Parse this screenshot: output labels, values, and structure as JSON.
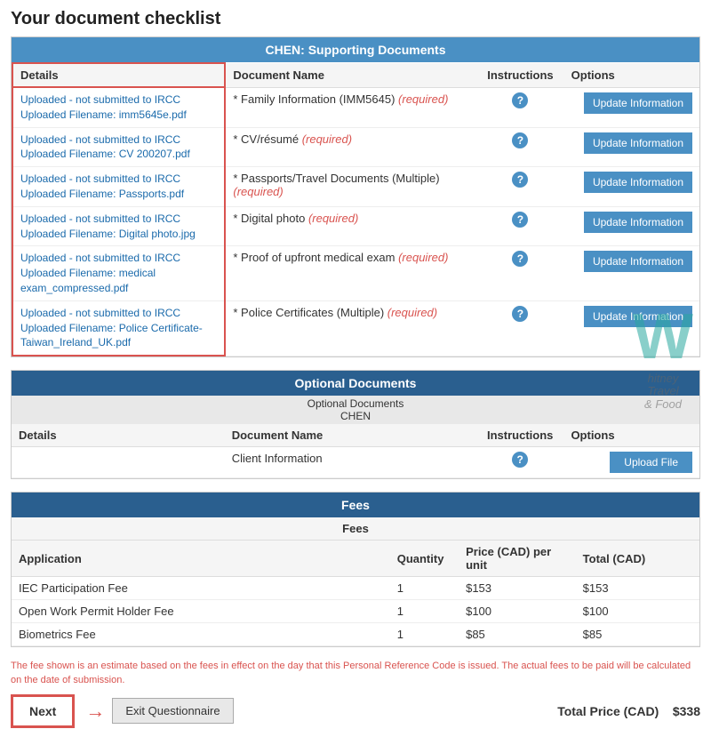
{
  "page": {
    "title": "Your document checklist"
  },
  "supporting_section": {
    "header": "CHEN: Supporting Documents",
    "columns": {
      "details": "Details",
      "document_name": "Document Name",
      "instructions": "Instructions",
      "options": "Options"
    },
    "rows": [
      {
        "details_line1": "Uploaded - not submitted to IRCC",
        "details_line2": "Uploaded Filename:  imm5645e.pdf",
        "doc_name": "* Family Information (IMM5645)",
        "required_label": "(required)",
        "btn_label": "Update Information"
      },
      {
        "details_line1": "Uploaded - not submitted to IRCC",
        "details_line2": "Uploaded Filename:  CV 200207.pdf",
        "doc_name": "* CV/résumé",
        "required_label": "(required)",
        "btn_label": "Update Information"
      },
      {
        "details_line1": "Uploaded - not submitted to IRCC",
        "details_line2": "Uploaded Filename:  Passports.pdf",
        "doc_name": "* Passports/Travel Documents (Multiple)",
        "required_label": "(required)",
        "btn_label": "Update Information"
      },
      {
        "details_line1": "Uploaded - not submitted to IRCC",
        "details_line2": "Uploaded Filename:  Digital photo.jpg",
        "doc_name": "* Digital photo",
        "required_label": "(required)",
        "btn_label": "Update Information"
      },
      {
        "details_line1": "Uploaded - not submitted to IRCC",
        "details_line2": "Uploaded Filename:  medical exam_compressed.pdf",
        "doc_name": "* Proof of upfront medical exam",
        "required_label": "(required)",
        "btn_label": "Update Information"
      },
      {
        "details_line1": "Uploaded - not submitted to IRCC",
        "details_line2": "Uploaded Filename:  Police Certificate-Taiwan_Ireland_UK.pdf",
        "doc_name": "* Police Certificates (Multiple)",
        "required_label": "(required)",
        "btn_label": "Update Information"
      }
    ]
  },
  "optional_section": {
    "header": "Optional Documents",
    "subheader_line1": "Optional Documents",
    "subheader_line2": "CHEN",
    "columns": {
      "details": "Details",
      "document_name": "Document Name",
      "instructions": "Instructions",
      "options": "Options"
    },
    "rows": [
      {
        "details": "",
        "doc_name": "Client Information",
        "btn_label": "Upload File"
      }
    ]
  },
  "fees_section": {
    "header": "Fees",
    "subheader": "Fees",
    "columns": {
      "application": "Application",
      "quantity": "Quantity",
      "price": "Price (CAD) per unit",
      "total": "Total (CAD)"
    },
    "rows": [
      {
        "application": "IEC Participation Fee",
        "quantity": "1",
        "price": "$153",
        "total": "$153"
      },
      {
        "application": "Open Work Permit Holder Fee",
        "quantity": "1",
        "price": "$100",
        "total": "$100"
      },
      {
        "application": "Biometrics Fee",
        "quantity": "1",
        "price": "$85",
        "total": "$85"
      }
    ],
    "total_label": "Total Price (CAD)",
    "total_value": "$338"
  },
  "footer": {
    "note": "The fee shown is an estimate based on the fees in effect on the day that this Personal Reference Code is issued. The actual fees to be paid will be calculated on the date of submission.",
    "next_btn": "Next",
    "exit_btn": "Exit Questionnaire"
  }
}
